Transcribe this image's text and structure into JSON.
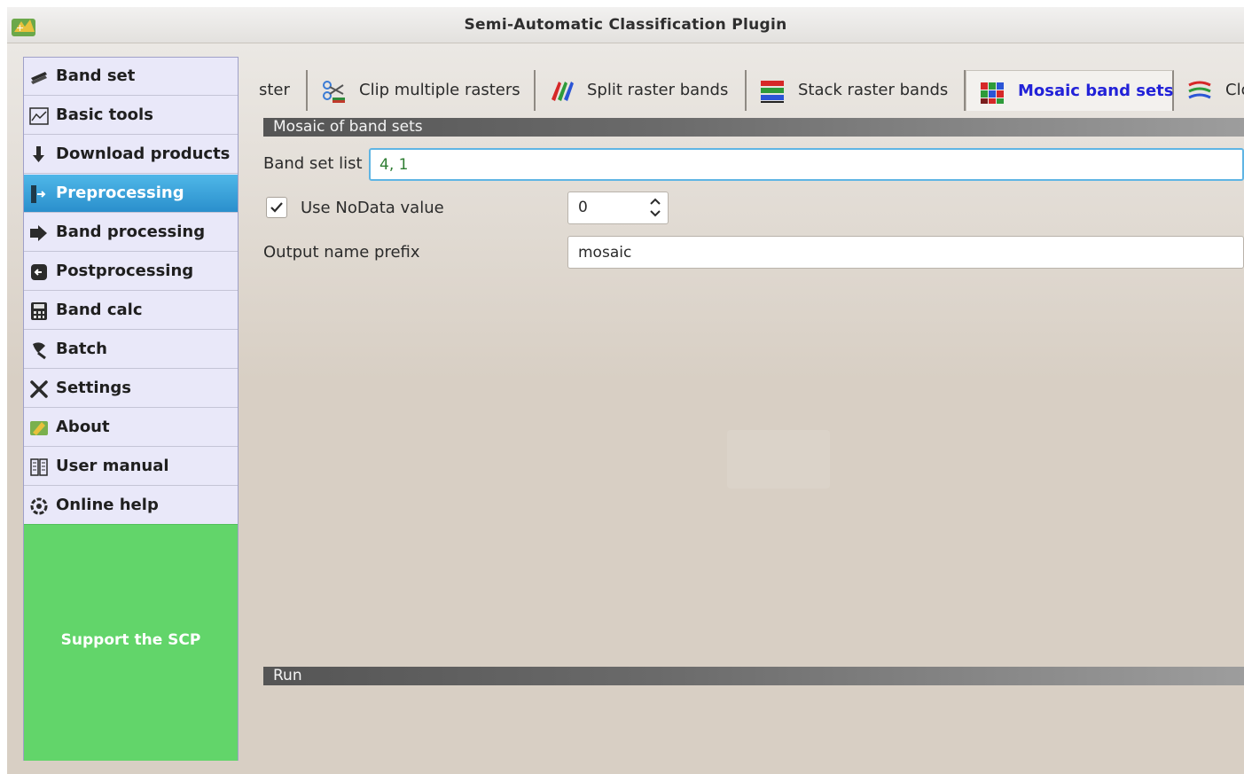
{
  "window": {
    "title": "Semi-Automatic Classification Plugin"
  },
  "sidebar": {
    "items": [
      {
        "label": "Band set",
        "icon": "band-set-icon"
      },
      {
        "label": "Basic tools",
        "icon": "basic-tools-icon"
      },
      {
        "label": "Download products",
        "icon": "download-icon"
      },
      {
        "label": "Preprocessing",
        "icon": "preprocessing-icon",
        "selected": true
      },
      {
        "label": "Band processing",
        "icon": "band-processing-icon"
      },
      {
        "label": "Postprocessing",
        "icon": "postprocessing-icon"
      },
      {
        "label": "Band calc",
        "icon": "calculator-icon"
      },
      {
        "label": "Batch",
        "icon": "batch-icon"
      },
      {
        "label": "Settings",
        "icon": "settings-icon"
      },
      {
        "label": "About",
        "icon": "about-icon"
      },
      {
        "label": "User manual",
        "icon": "user-manual-icon"
      },
      {
        "label": "Online help",
        "icon": "online-help-icon"
      }
    ],
    "support_label": "Support the SCP",
    "selected_color": "#2a8fcc",
    "support_color": "#62d56a"
  },
  "tabs": [
    {
      "label": "ster",
      "icon": ""
    },
    {
      "label": "Clip multiple rasters",
      "icon": "clip-icon"
    },
    {
      "label": "Split raster bands",
      "icon": "split-bands-icon"
    },
    {
      "label": "Stack raster bands",
      "icon": "stack-bands-icon"
    },
    {
      "label": "Mosaic band sets",
      "icon": "mosaic-icon",
      "active": true
    },
    {
      "label": "Clo",
      "icon": "cloud-icon"
    }
  ],
  "mosaic": {
    "section_title": "Mosaic of band sets",
    "band_set_list_label": "Band set list",
    "band_set_list_value": "4, 1",
    "use_nodata_label": "Use NoData value",
    "use_nodata_checked": true,
    "nodata_value": "0",
    "output_prefix_label": "Output name prefix",
    "output_prefix_value": "mosaic"
  },
  "run": {
    "section_title": "Run"
  },
  "colors": {
    "active_tab_text": "#2222d8",
    "band_input_text": "#2e7d32",
    "focus_border": "#5fb5e4"
  }
}
